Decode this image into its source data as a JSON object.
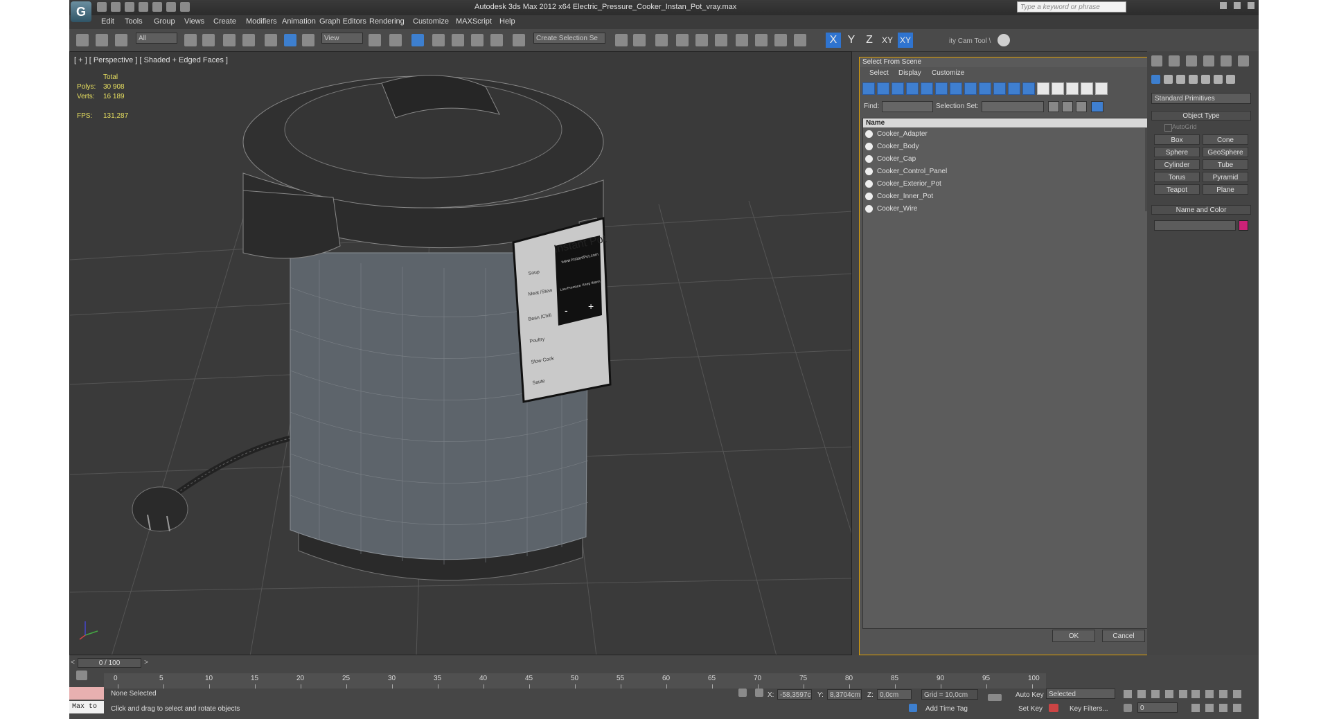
{
  "app": {
    "logo": "G",
    "title": "Autodesk 3ds Max  2012 x64     Electric_Pressure_Cooker_Instan_Pot_vray.max",
    "search_placeholder": "Type a keyword or phrase"
  },
  "menu": [
    "Edit",
    "Tools",
    "Group",
    "Views",
    "Create",
    "Modifiers",
    "Animation",
    "Graph Editors",
    "Rendering",
    "Customize",
    "MAXScript",
    "Help"
  ],
  "toolbar": {
    "filter_combo": "All",
    "ref_coord_combo": "View",
    "selection_set_combo": "Create Selection Se",
    "snap_3": "3",
    "angle_snap": "∠",
    "percent_snap": "%",
    "axis_x": "X",
    "axis_y": "Y",
    "axis_z": "Z",
    "axis_xy": "XY",
    "axis_xy2": "XY",
    "cam_tools": "ity Cam Tool \\"
  },
  "viewport": {
    "label": "[ + ] [ Perspective ] [ Shaded + Edged Faces ]",
    "stats": {
      "total_label": "Total",
      "polys_label": "Polys:",
      "polys_value": "30 908",
      "verts_label": "Verts:",
      "verts_value": "16 189",
      "fps_label": "FPS:",
      "fps_value": "131,287"
    },
    "panel_text": {
      "brand": "Instant Pot",
      "url": "www.InstantPot.com",
      "buttons": [
        "Soup",
        "Meat /Stew",
        "Bean /Chili",
        "Poultry",
        "Slow Cook",
        "Saute"
      ],
      "display_top": "Low Pressure",
      "display_right": "Keep Warm",
      "minus": "-",
      "plus": "+"
    }
  },
  "select_dialog": {
    "title": "Select From Scene",
    "close": "x",
    "menu": [
      "Select",
      "Display",
      "Customize"
    ],
    "find_label": "Find:",
    "selection_set_label": "Selection Set:",
    "column_name": "Name",
    "items": [
      "Cooker_Adapter",
      "Cooker_Body",
      "Cooker_Cap",
      "Cooker_Control_Panel",
      "Cooker_Exterior_Pot",
      "Cooker_Inner_Pot",
      "Cooker_Wire"
    ],
    "ok": "OK",
    "cancel": "Cancel"
  },
  "command_panel": {
    "category": "Standard Primitives",
    "object_type_title": "Object Type",
    "autogrid_label": "AutoGrid",
    "primitives": [
      "Box",
      "Cone",
      "Sphere",
      "GeoSphere",
      "Cylinder",
      "Tube",
      "Torus",
      "Pyramid",
      "Teapot",
      "Plane"
    ],
    "name_color_title": "Name and Color",
    "color": "#cc2277"
  },
  "timeline": {
    "time_slider": "0 / 100",
    "prev_arrow": "<",
    "next_arrow": ">",
    "ticks": [
      "0",
      "5",
      "10",
      "15",
      "20",
      "25",
      "30",
      "35",
      "40",
      "45",
      "50",
      "55",
      "60",
      "65",
      "70",
      "75",
      "80",
      "85",
      "90",
      "95",
      "100"
    ]
  },
  "status": {
    "selection": "None Selected",
    "prompt": "Click and drag to select and rotate objects",
    "maxscript": "Max to",
    "x_label": "X:",
    "x_value": "-58,3597c",
    "y_label": "Y:",
    "y_value": "8,3704cm",
    "z_label": "Z:",
    "z_value": "0,0cm",
    "grid": "Grid = 10,0cm",
    "add_time_tag": "Add Time Tag",
    "auto_key": "Auto Key",
    "set_key": "Set Key",
    "key_mode": "Selected",
    "key_filters": "Key Filters...",
    "frame_value": "0"
  }
}
